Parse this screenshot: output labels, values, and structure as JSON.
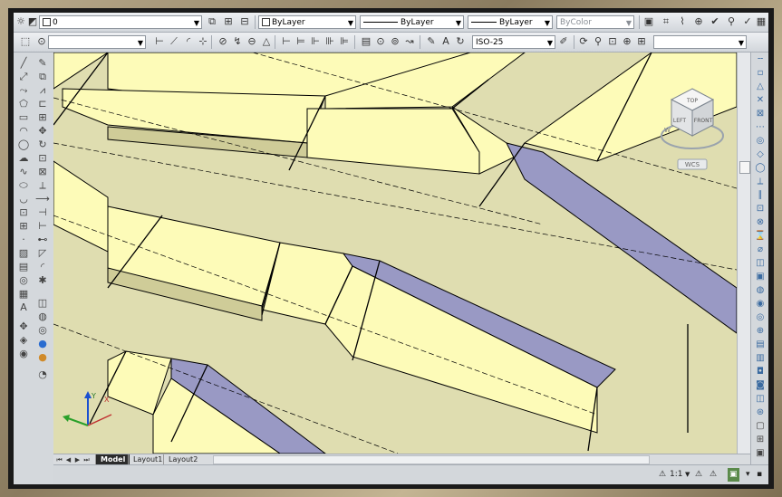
{
  "toolbar1": {
    "layer_value": "0",
    "color_value": "ByLayer",
    "linetype_value": "ByLayer",
    "lineweight_value": "ByLayer",
    "plotstyle_value": "ByColor"
  },
  "toolbar2": {
    "dimstyle_value": "ISO-25"
  },
  "viewcube": {
    "top": "TOP",
    "left": "LEFT",
    "front": "FRONT",
    "compass_w": "W",
    "wcs": "WCS"
  },
  "ucs": {
    "x": "X",
    "y": "Y"
  },
  "tabs": [
    {
      "label": "Model"
    },
    {
      "label": "Layout1"
    },
    {
      "label": "Layout2"
    }
  ],
  "status": {
    "annotation_scale": "1:1"
  },
  "colors": {
    "viewport_bg": "#dfddb0",
    "face_light": "#fdfbb8",
    "face_mid": "#ebe9a8",
    "face_shadow": "#cfcc98",
    "face_blue": "#9999c4",
    "edge": "#000000",
    "accent": "#3a6aa0"
  }
}
